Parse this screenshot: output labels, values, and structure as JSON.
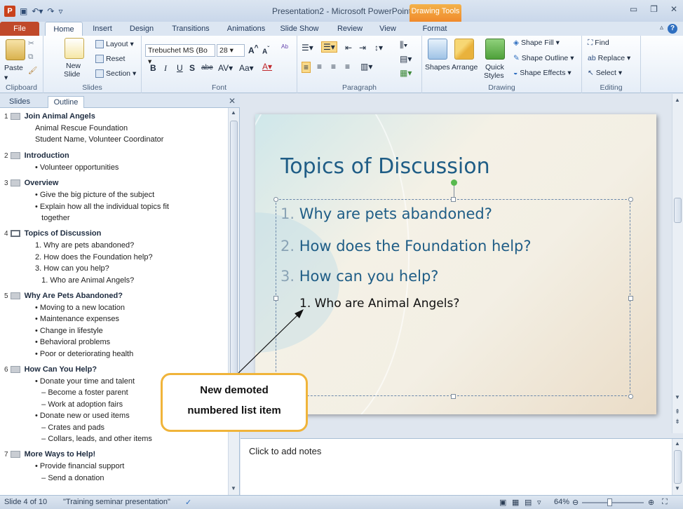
{
  "window": {
    "title": "Presentation2 - Microsoft PowerPoint",
    "contextual_tab": "Drawing Tools",
    "app_icon_letter": "P",
    "qat_icons": [
      "save-icon",
      "undo-icon",
      "redo-icon",
      "customize-icon"
    ]
  },
  "ribbon_tabs": [
    "File",
    "Home",
    "Insert",
    "Design",
    "Transitions",
    "Animations",
    "Slide Show",
    "Review",
    "View",
    "Format"
  ],
  "ribbon": {
    "clipboard": {
      "label": "Clipboard",
      "paste": "Paste"
    },
    "slides": {
      "label": "Slides",
      "new_slide_1": "New",
      "new_slide_2": "Slide",
      "layout": "Layout",
      "reset": "Reset",
      "section": "Section"
    },
    "font": {
      "label": "Font",
      "font_name": "Trebuchet MS (Bo",
      "font_size": "28"
    },
    "paragraph": {
      "label": "Paragraph"
    },
    "drawing": {
      "label": "Drawing",
      "shapes": "Shapes",
      "arrange": "Arrange",
      "quick_styles_1": "Quick",
      "quick_styles_2": "Styles",
      "shape_fill": "Shape Fill",
      "shape_outline": "Shape Outline",
      "shape_effects": "Shape Effects"
    },
    "editing": {
      "label": "Editing",
      "find": "Find",
      "replace": "Replace",
      "select": "Select"
    }
  },
  "pane_tabs": {
    "slides": "Slides",
    "outline": "Outline"
  },
  "outline": [
    {
      "num": "1",
      "title": "Join Animal Angels",
      "lines": [
        "Animal Rescue Foundation",
        "Student Name, Volunteer Coordinator"
      ]
    },
    {
      "num": "2",
      "title": "Introduction",
      "lines": [
        "• Volunteer opportunities"
      ]
    },
    {
      "num": "3",
      "title": "Overview",
      "lines": [
        "• Give the big picture of the subject",
        "• Explain how all the individual topics fit",
        "   together"
      ]
    },
    {
      "num": "4",
      "title": "Topics of Discussion",
      "lines": [
        "1. Why are pets abandoned?",
        "2. How does the Foundation help?",
        "3. How can you help?",
        "   1. Who are Animal Angels?"
      ]
    },
    {
      "num": "5",
      "title": "Why Are Pets Abandoned?",
      "lines": [
        "• Moving to a new location",
        "• Maintenance expenses",
        "• Change in lifestyle",
        "• Behavioral problems",
        "• Poor or deteriorating health"
      ]
    },
    {
      "num": "6",
      "title": "How Can You Help?",
      "lines": [
        "• Donate your time and talent",
        "   – Become a foster parent",
        "   – Work at adoption fairs",
        "• Donate new or used items",
        "   – Crates and pads",
        "   – Collars, leads, and other items"
      ]
    },
    {
      "num": "7",
      "title": "More Ways to Help!",
      "lines": [
        "• Provide financial support",
        "   – Send a donation"
      ]
    }
  ],
  "slide": {
    "title": "Topics of Discussion",
    "items": [
      {
        "n": "1.",
        "text": "Why are pets abandoned?"
      },
      {
        "n": "2.",
        "text": "How does the Foundation help?"
      },
      {
        "n": "3.",
        "text": "How can you help?"
      }
    ],
    "subitem": "1.  Who are Animal Angels?"
  },
  "notes_placeholder": "Click to add notes",
  "callout": {
    "line1": "New demoted",
    "line2": "numbered list item"
  },
  "status": {
    "slide_info": "Slide 4 of 10",
    "theme": "\"Training seminar presentation\"",
    "zoom": "64%"
  }
}
